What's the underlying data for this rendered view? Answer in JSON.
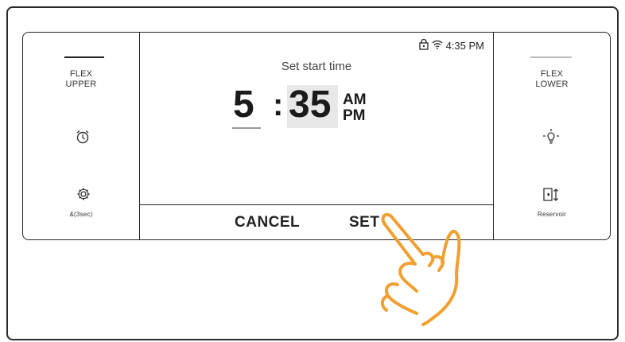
{
  "left_panel": {
    "title_line1": "FLEX",
    "title_line2": "UPPER",
    "alarm_icon": "alarm-clock-icon",
    "settings_icon": "gear-icon",
    "settings_caption": "&(3sec)"
  },
  "right_panel": {
    "title_line1": "FLEX",
    "title_line2": "LOWER",
    "light_icon": "light-bulb-icon",
    "reservoir_icon": "reservoir-icon",
    "reservoir_caption": "Reservoir"
  },
  "display": {
    "status_time": "4:35 PM",
    "status_icons": [
      "lock-icon",
      "wifi-icon"
    ],
    "prompt": "Set start time",
    "hour": "5",
    "separator": ":",
    "minute": "35",
    "am": "AM",
    "pm": "PM"
  },
  "buttons": {
    "cancel": "CANCEL",
    "set": "SET"
  },
  "colors": {
    "hand_outline": "#f0a030",
    "border": "#222222"
  }
}
